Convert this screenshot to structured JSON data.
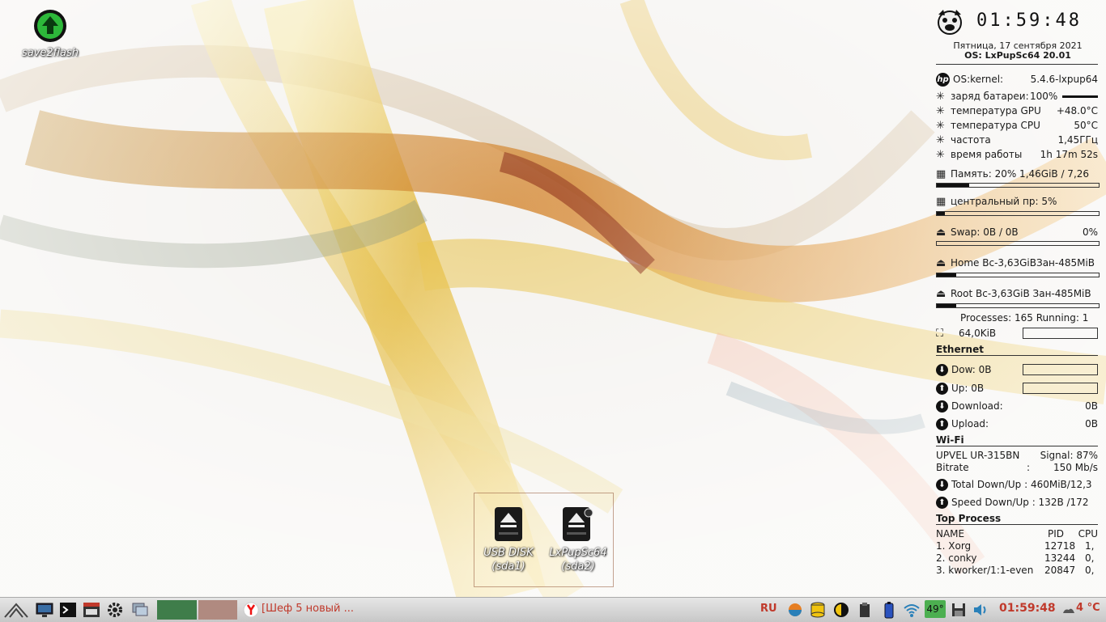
{
  "desktop": {
    "icons": [
      {
        "label": "save2flash"
      }
    ],
    "drives": [
      {
        "line1": "USB DISK",
        "line2": "(sda1)"
      },
      {
        "line1": "LxPupSc64",
        "line2": "(sda2)"
      }
    ]
  },
  "conky": {
    "clock": "01:59:48",
    "date": "Пятница, 17 сентября 2021",
    "os": "OS: LxPupSc64 20.01",
    "kernel": {
      "label": "OS:kernel:",
      "value": "5.4.6-lxpup64"
    },
    "battery": {
      "label": "заряд батареи:",
      "value": "100%"
    },
    "gpu_temp": {
      "label": "температура  GPU",
      "value": "+48.0°C"
    },
    "cpu_temp": {
      "label": "температура  CPU",
      "value": "50°C"
    },
    "freq": {
      "label": "частота",
      "value": "1,45ГГц"
    },
    "uptime": {
      "label": "время работы",
      "value": "1h 17m 52s"
    },
    "memory": {
      "text": "Память: 20% 1,46GiB / 7,26",
      "percent": 20
    },
    "cpu": {
      "text": "центральный пр: 5%",
      "percent": 5
    },
    "swap": {
      "text": "Swap: 0B   / 0B",
      "value": "0%",
      "percent": 0
    },
    "home": {
      "text": "Home Вс-3,63GiBЗан-485MiB",
      "percent": 12
    },
    "root": {
      "text": "Root Вс-3,63GiB Зан-485MiB",
      "percent": 12
    },
    "processes": "Processes: 165 Running: 1",
    "proc_mem": "64,0KiB",
    "ethernet": {
      "title": "Ethernet",
      "down": "Dow: 0B",
      "up": "Up: 0B",
      "download": {
        "label": "Download:",
        "value": "0B"
      },
      "upload": {
        "label": "Upload:",
        "value": "0B"
      }
    },
    "wifi": {
      "title": "Wi-Fi",
      "ssid": "UPVEL UR-315BN",
      "signal": "Signal: 87%",
      "bitrate_label": "Bitrate",
      "bitrate_sep": ":",
      "bitrate": "150 Mb/s",
      "total": "Total Down/Up : 460MiB/12,3",
      "speed": "Speed Down/Up : 132B  /172"
    },
    "top": {
      "title": "Top Process",
      "headers": {
        "name": "NAME",
        "pid": "PID",
        "cpu": "CPU"
      },
      "rows": [
        {
          "name": "1. Xorg",
          "pid": "12718",
          "cpu": "1,"
        },
        {
          "name": "2. conky",
          "pid": "13244",
          "cpu": "0,"
        },
        {
          "name": "3. kworker/1:1-even",
          "pid": "20847",
          "cpu": "0,"
        }
      ]
    }
  },
  "taskbar": {
    "window_title": "[Шеф 5 новый ...",
    "lang": "RU",
    "cpu_temp_badge": "49°",
    "time": "01:59:48",
    "weather": "4 °C",
    "colors": {
      "desk1": "#3f7d4a",
      "desk2": "#b08a80",
      "accent": "#c0392b"
    }
  }
}
